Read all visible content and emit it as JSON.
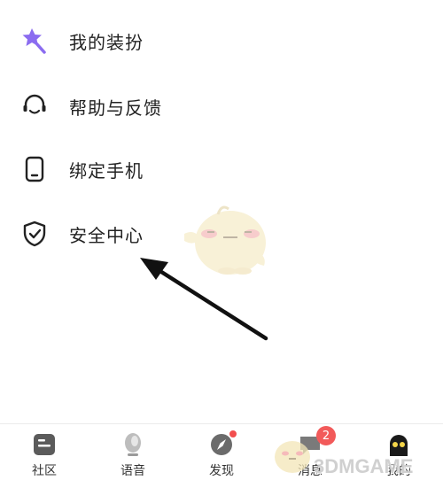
{
  "menu": {
    "items": [
      {
        "label": "我的装扮",
        "icon": "magic-wand-star-icon"
      },
      {
        "label": "帮助与反馈",
        "icon": "headset-icon"
      },
      {
        "label": "绑定手机",
        "icon": "phone-icon"
      },
      {
        "label": "安全中心",
        "icon": "shield-check-icon"
      }
    ]
  },
  "tabbar": {
    "tabs": [
      {
        "label": "社区",
        "icon": "community-icon"
      },
      {
        "label": "语音",
        "icon": "voice-icon"
      },
      {
        "label": "发现",
        "icon": "compass-icon"
      },
      {
        "label": "消息",
        "icon": "message-icon",
        "badge": "2"
      },
      {
        "label": "我的",
        "icon": "profile-avatar-icon"
      }
    ]
  },
  "watermark": {
    "text": "3DMGAME"
  },
  "colors": {
    "accent_purple": "#8b6cf0",
    "badge_red": "#f25a5a"
  }
}
